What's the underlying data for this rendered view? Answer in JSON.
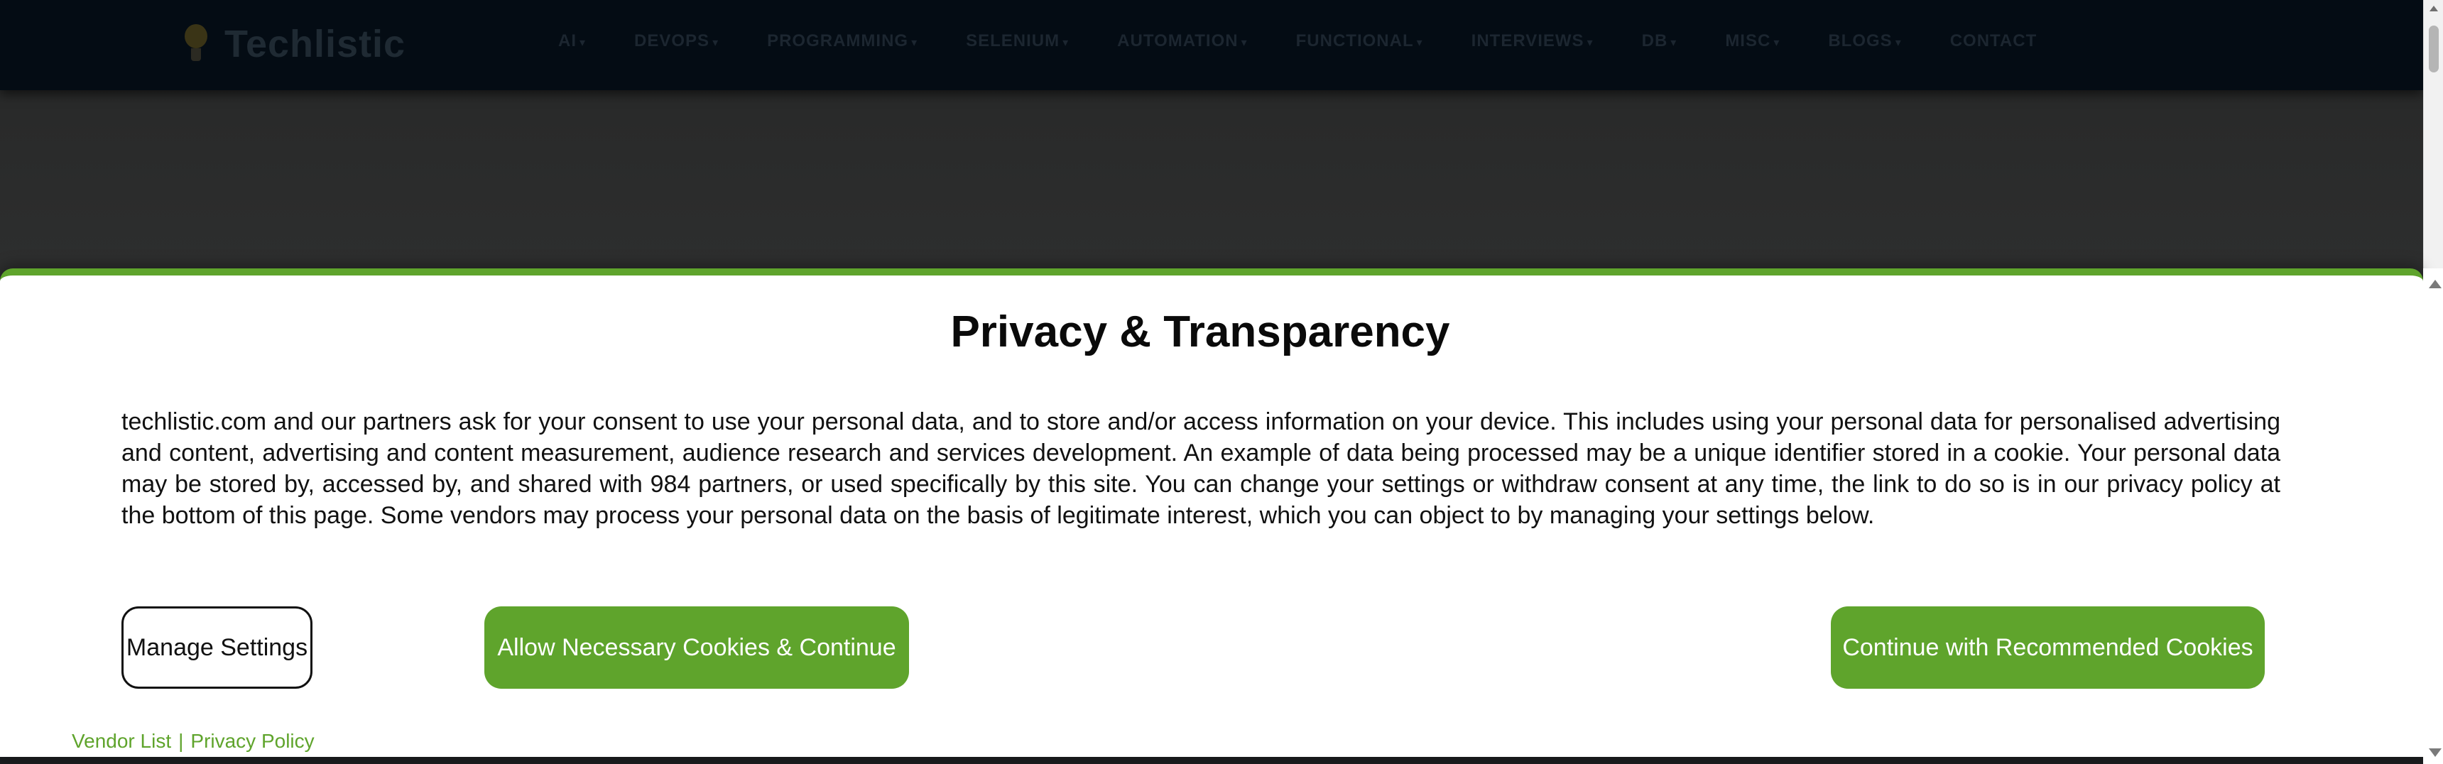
{
  "site": {
    "logo_text": "Techlistic",
    "nav": [
      {
        "label": "AI"
      },
      {
        "label": "DEVOPS"
      },
      {
        "label": "PROGRAMMING"
      },
      {
        "label": "SELENIUM"
      },
      {
        "label": "AUTOMATION"
      },
      {
        "label": "FUNCTIONAL"
      },
      {
        "label": "INTERVIEWS"
      },
      {
        "label": "DB"
      },
      {
        "label": "MISC"
      },
      {
        "label": "BLOGS"
      },
      {
        "label": "CONTACT"
      }
    ]
  },
  "consent": {
    "title": "Privacy & Transparency",
    "body": "techlistic.com and our partners ask for your consent to use your personal data, and to store and/or access information on your device. This includes using your personal data for personalised advertising and content, advertising and content measurement, audience research and services development. An example of data being processed may be a unique identifier stored in a cookie. Your personal data may be stored by, accessed by, and shared with 984 partners, or used specifically by this site. You can change your settings or withdraw consent at any time, the link to do so is in our privacy policy at the bottom of this page. Some vendors may process your personal data on the basis of legitimate interest, which you can object to by managing your settings below.",
    "manage_settings_label": "Manage Settings",
    "allow_necessary_label": "Allow Necessary Cookies & Continue",
    "recommended_label": "Continue with Recommended Cookies",
    "vendor_list_label": "Vendor List",
    "separator": "|",
    "privacy_policy_label": "Privacy Policy"
  },
  "colors": {
    "accent": "#5fa42c",
    "header_bg": "#040c14"
  }
}
